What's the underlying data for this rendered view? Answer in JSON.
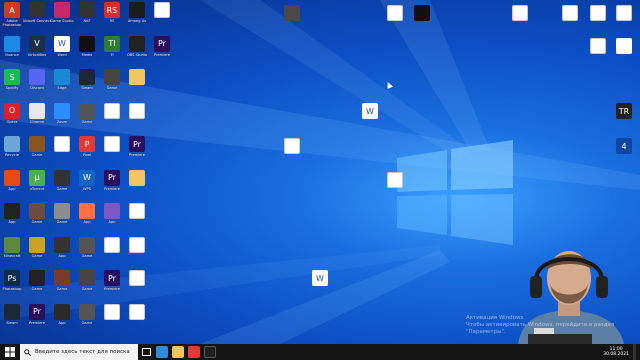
{
  "desktop": {
    "icons": [
      {
        "label": "Adobe Photoshop",
        "name": "desktop-icon-app",
        "kind": "app",
        "color": "#c93b24",
        "text": "A"
      },
      {
        "label": "Ubisoft Connect",
        "name": "desktop-icon-app",
        "kind": "app",
        "color": "#333333",
        "text": ""
      },
      {
        "label": "Game Studio",
        "name": "desktop-icon-app",
        "kind": "app",
        "color": "#c42a6a",
        "text": ""
      },
      {
        "label": "NKF",
        "name": "desktop-icon-app",
        "kind": "app",
        "color": "#333333",
        "text": ""
      },
      {
        "label": "RS",
        "name": "desktop-icon-app",
        "kind": "app",
        "color": "#d32f2f",
        "text": "RS"
      },
      {
        "label": "Among Us",
        "name": "desktop-icon-app",
        "kind": "app",
        "color": "#1d1d1d",
        "text": ""
      },
      {
        "label": "",
        "name": "desktop-icon-file",
        "kind": "file",
        "color": "#ffffff",
        "text": ""
      },
      {
        "label": "Nuance",
        "name": "desktop-icon-app",
        "kind": "app",
        "color": "#1e88e5",
        "text": ""
      },
      {
        "label": "VirtualBox",
        "name": "desktop-icon-app",
        "kind": "app",
        "color": "#1b2f4a",
        "text": "V"
      },
      {
        "label": "Word",
        "name": "desktop-icon-app",
        "kind": "app",
        "color": "#ffffff",
        "text": "W"
      },
      {
        "label": "Media",
        "name": "desktop-icon-app",
        "kind": "app",
        "color": "#111111",
        "text": ""
      },
      {
        "label": "TI",
        "name": "desktop-icon-app",
        "kind": "app",
        "color": "#2e7d32",
        "text": "TI"
      },
      {
        "label": "OBS Studio",
        "name": "desktop-icon-app",
        "kind": "app",
        "color": "#222222",
        "text": ""
      },
      {
        "label": "Premiere",
        "name": "desktop-icon-app",
        "kind": "app",
        "color": "#2a0f5e",
        "text": "Pr"
      },
      {
        "label": "Spotify",
        "name": "desktop-icon-app",
        "kind": "app",
        "color": "#1db954",
        "text": "S"
      },
      {
        "label": "Discord",
        "name": "desktop-icon-app",
        "kind": "app",
        "color": "#5865f2",
        "text": ""
      },
      {
        "label": "Edge",
        "name": "desktop-icon-app",
        "kind": "app",
        "color": "#1a8ad4",
        "text": ""
      },
      {
        "label": "Steam",
        "name": "desktop-icon-app",
        "kind": "app",
        "color": "#1b2838",
        "text": ""
      },
      {
        "label": "Game",
        "name": "desktop-icon-app",
        "kind": "app",
        "color": "#444444",
        "text": ""
      },
      {
        "label": "",
        "name": "desktop-icon-folder",
        "kind": "folder",
        "color": "#f0c75e",
        "text": ""
      },
      {
        "label": "",
        "name": "desktop-icon-blank",
        "kind": "none",
        "color": "",
        "text": ""
      },
      {
        "label": "Opera",
        "name": "desktop-icon-app",
        "kind": "app",
        "color": "#e11d2a",
        "text": "O"
      },
      {
        "label": "Chrome",
        "name": "desktop-icon-app",
        "kind": "app",
        "color": "#e8e8e8",
        "text": ""
      },
      {
        "label": "Zoom",
        "name": "desktop-icon-app",
        "kind": "app",
        "color": "#2d8cff",
        "text": ""
      },
      {
        "label": "Game",
        "name": "desktop-icon-app",
        "kind": "app",
        "color": "#555555",
        "text": ""
      },
      {
        "label": "",
        "name": "desktop-icon-file",
        "kind": "file",
        "color": "#ffffff",
        "text": ""
      },
      {
        "label": "",
        "name": "desktop-icon-file",
        "kind": "file",
        "color": "#ffffff",
        "text": ""
      },
      {
        "label": "",
        "name": "desktop-icon-blank",
        "kind": "none",
        "color": "",
        "text": ""
      },
      {
        "label": "Recycle",
        "name": "desktop-icon-app",
        "kind": "app",
        "color": "#6aa6d8",
        "text": ""
      },
      {
        "label": "Game",
        "name": "desktop-icon-app",
        "kind": "app",
        "color": "#885522",
        "text": ""
      },
      {
        "label": "",
        "name": "desktop-icon-file",
        "kind": "file",
        "color": "#ffffff",
        "text": ""
      },
      {
        "label": "Pixel",
        "name": "desktop-icon-app",
        "kind": "app",
        "color": "#e53935",
        "text": "P"
      },
      {
        "label": "",
        "name": "desktop-icon-file",
        "kind": "file",
        "color": "#ffffff",
        "text": ""
      },
      {
        "label": "Premiere",
        "name": "desktop-icon-app",
        "kind": "app",
        "color": "#2a0f5e",
        "text": "Pr"
      },
      {
        "label": "",
        "name": "desktop-icon-blank",
        "kind": "none",
        "color": "",
        "text": ""
      },
      {
        "label": "App",
        "name": "desktop-icon-app",
        "kind": "app",
        "color": "#e64a19",
        "text": ""
      },
      {
        "label": "uTorrent",
        "name": "desktop-icon-app",
        "kind": "app",
        "color": "#4caf50",
        "text": "µ"
      },
      {
        "label": "Game",
        "name": "desktop-icon-app",
        "kind": "app",
        "color": "#333333",
        "text": ""
      },
      {
        "label": "WPS",
        "name": "desktop-icon-app",
        "kind": "app",
        "color": "#1565c0",
        "text": "W"
      },
      {
        "label": "Premiere",
        "name": "desktop-icon-app",
        "kind": "app",
        "color": "#2a0f5e",
        "text": "Pr"
      },
      {
        "label": "",
        "name": "desktop-icon-folder",
        "kind": "folder",
        "color": "#f0c75e",
        "text": ""
      },
      {
        "label": "",
        "name": "desktop-icon-blank",
        "kind": "none",
        "color": "",
        "text": ""
      },
      {
        "label": "App",
        "name": "desktop-icon-app",
        "kind": "app",
        "color": "#222222",
        "text": ""
      },
      {
        "label": "Game",
        "name": "desktop-icon-app",
        "kind": "app",
        "color": "#6d4c41",
        "text": ""
      },
      {
        "label": "Game",
        "name": "desktop-icon-app",
        "kind": "app",
        "color": "#8d8d8d",
        "text": ""
      },
      {
        "label": "App",
        "name": "desktop-icon-app",
        "kind": "app",
        "color": "#ff7043",
        "text": ""
      },
      {
        "label": "App",
        "name": "desktop-icon-app",
        "kind": "app",
        "color": "#7e57c2",
        "text": ""
      },
      {
        "label": "",
        "name": "desktop-icon-file",
        "kind": "file",
        "color": "#ffffff",
        "text": ""
      },
      {
        "label": "",
        "name": "desktop-icon-blank",
        "kind": "none",
        "color": "",
        "text": ""
      },
      {
        "label": "Minecraft",
        "name": "desktop-icon-app",
        "kind": "app",
        "color": "#5d8a3a",
        "text": ""
      },
      {
        "label": "Game",
        "name": "desktop-icon-app",
        "kind": "app",
        "color": "#c9a227",
        "text": ""
      },
      {
        "label": "App",
        "name": "desktop-icon-app",
        "kind": "app",
        "color": "#333333",
        "text": ""
      },
      {
        "label": "Game",
        "name": "desktop-icon-app",
        "kind": "app",
        "color": "#555555",
        "text": ""
      },
      {
        "label": "",
        "name": "desktop-icon-file",
        "kind": "file",
        "color": "#ffffff",
        "text": ""
      },
      {
        "label": "",
        "name": "desktop-icon-file",
        "kind": "file",
        "color": "#ffffff",
        "text": ""
      },
      {
        "label": "",
        "name": "desktop-icon-blank",
        "kind": "none",
        "color": "",
        "text": ""
      },
      {
        "label": "Photoshop",
        "name": "desktop-icon-app",
        "kind": "app",
        "color": "#0f2a4a",
        "text": "Ps"
      },
      {
        "label": "Game",
        "name": "desktop-icon-app",
        "kind": "app",
        "color": "#222222",
        "text": ""
      },
      {
        "label": "Game",
        "name": "desktop-icon-app",
        "kind": "app",
        "color": "#7a3b2e",
        "text": ""
      },
      {
        "label": "Game",
        "name": "desktop-icon-app",
        "kind": "app",
        "color": "#444444",
        "text": ""
      },
      {
        "label": "Premiere",
        "name": "desktop-icon-app",
        "kind": "app",
        "color": "#2a0f5e",
        "text": "Pr"
      },
      {
        "label": "",
        "name": "desktop-icon-file",
        "kind": "file",
        "color": "#ffffff",
        "text": ""
      },
      {
        "label": "",
        "name": "desktop-icon-blank",
        "kind": "none",
        "color": "",
        "text": ""
      },
      {
        "label": "Steam",
        "name": "desktop-icon-app",
        "kind": "app",
        "color": "#1b2838",
        "text": ""
      },
      {
        "label": "Premiere",
        "name": "desktop-icon-app",
        "kind": "app",
        "color": "#2a0f5e",
        "text": "Pr"
      },
      {
        "label": "App",
        "name": "desktop-icon-app",
        "kind": "app",
        "color": "#2b2b2b",
        "text": ""
      },
      {
        "label": "Game",
        "name": "desktop-icon-app",
        "kind": "app",
        "color": "#555555",
        "text": ""
      },
      {
        "label": "",
        "name": "desktop-icon-file",
        "kind": "file",
        "color": "#ffffff",
        "text": ""
      },
      {
        "label": "",
        "name": "desktop-icon-file",
        "kind": "file",
        "color": "#ffffff",
        "text": ""
      },
      {
        "label": "",
        "name": "desktop-icon-blank",
        "kind": "none",
        "color": "",
        "text": ""
      }
    ],
    "extra_icons": [
      {
        "label": "",
        "name": "desktop-icon-app",
        "kind": "app",
        "color": "#4a4a4a",
        "text": ""
      },
      {
        "label": "",
        "name": "desktop-icon-file",
        "kind": "file",
        "color": "#ffffff",
        "text": ""
      },
      {
        "label": "",
        "name": "desktop-icon-app",
        "kind": "app",
        "color": "#111111",
        "text": ""
      },
      {
        "label": "",
        "name": "desktop-icon-file",
        "kind": "file",
        "color": "#ffffff",
        "text": ""
      },
      {
        "label": "",
        "name": "desktop-icon-file",
        "kind": "file",
        "color": "#ffffff",
        "text": ""
      },
      {
        "label": "",
        "name": "desktop-icon-file",
        "kind": "file",
        "color": "#ffffff",
        "text": ""
      },
      {
        "label": "",
        "name": "desktop-icon-file",
        "kind": "file",
        "color": "#ffffff",
        "text": ""
      },
      {
        "label": "",
        "name": "desktop-icon-file",
        "kind": "file",
        "color": "#ffffff",
        "text": ""
      },
      {
        "label": "",
        "name": "desktop-icon-app",
        "kind": "app",
        "color": "#ffffff",
        "text": "W"
      },
      {
        "label": "",
        "name": "desktop-icon-file",
        "kind": "file",
        "color": "#ffffff",
        "text": ""
      },
      {
        "label": "",
        "name": "desktop-icon-file",
        "kind": "file",
        "color": "#ffffff",
        "text": ""
      },
      {
        "label": "",
        "name": "desktop-icon-app",
        "kind": "app",
        "color": "#ffffff",
        "text": "W"
      },
      {
        "label": "",
        "name": "desktop-icon-app",
        "kind": "app",
        "color": "#ffffff",
        "text": ""
      },
      {
        "label": "",
        "name": "desktop-icon-app",
        "kind": "app",
        "color": "#222222",
        "text": "TR"
      },
      {
        "label": "",
        "name": "desktop-icon-app",
        "kind": "app",
        "color": "#0d47a1",
        "text": "4"
      }
    ]
  },
  "activation": {
    "line1": "Активация Windows",
    "line2": "Чтобы активировать Windows, перейдите в раздел \"Параметры\"."
  },
  "taskbar": {
    "search_placeholder": "Введите здесь текст для поиска",
    "time": "11:00",
    "date": "30.08.2021",
    "accent": "#0078d7"
  }
}
